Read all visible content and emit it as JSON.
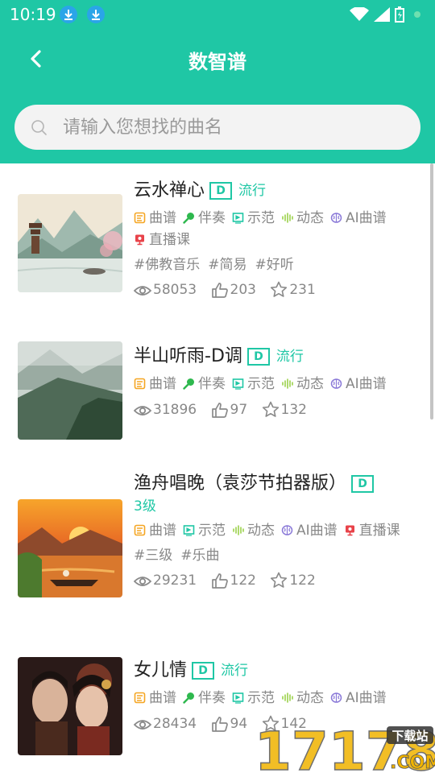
{
  "status": {
    "time": "10:19",
    "icons": [
      "download-icon",
      "download-icon",
      "wifi-icon",
      "signal-icon",
      "battery-icon"
    ]
  },
  "header": {
    "title": "数智谱",
    "back_icon": "chevron-left-icon"
  },
  "search": {
    "placeholder": "请输入您想找的曲名",
    "value": ""
  },
  "feature_labels": {
    "score": "曲谱",
    "accompany": "伴奏",
    "demo": "示范",
    "dynamic": "动态",
    "ai": "AI曲谱",
    "live": "直播课"
  },
  "songs": [
    {
      "name": "云水禅心",
      "key": "D",
      "genre": "流行",
      "features": [
        "score",
        "accompany",
        "demo",
        "dynamic",
        "ai",
        "live"
      ],
      "tags": [
        "#佛教音乐",
        "#简易",
        "#好听"
      ],
      "views": "58053",
      "likes": "203",
      "stars": "231"
    },
    {
      "name": "半山听雨-D调",
      "key": "D",
      "genre": "流行",
      "features": [
        "score",
        "accompany",
        "demo",
        "dynamic",
        "ai"
      ],
      "tags": [],
      "views": "31896",
      "likes": "97",
      "stars": "132"
    },
    {
      "name": "渔舟唱晚（袁莎节拍器版）",
      "key": "D",
      "genre": "3级",
      "features": [
        "score",
        "demo",
        "dynamic",
        "ai",
        "live"
      ],
      "tags": [
        "#三级",
        "#乐曲"
      ],
      "views": "29231",
      "likes": "122",
      "stars": "122"
    },
    {
      "name": "女儿情",
      "key": "D",
      "genre": "流行",
      "features": [
        "score",
        "accompany",
        "demo",
        "dynamic",
        "ai"
      ],
      "tags": [],
      "views": "28434",
      "likes": "94",
      "stars": "142"
    }
  ],
  "watermark": {
    "number": "17178",
    "tag": "下载站",
    "domain": ".COM"
  },
  "colors": {
    "accent": "#1fc7a5",
    "text_gray": "#888888",
    "score_icon": "#f5a623",
    "accompany_icon": "#2eb84e",
    "demo_icon": "#1fc7a5",
    "dynamic_icon": "#9bd14a",
    "ai_icon": "#8a79d8",
    "live_icon": "#e8434a"
  }
}
